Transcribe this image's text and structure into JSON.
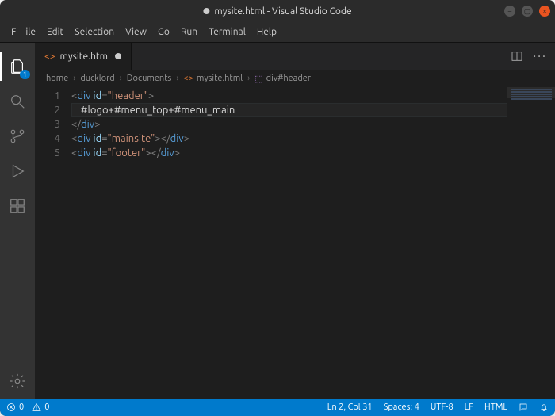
{
  "window": {
    "title": "mysite.html - Visual Studio Code",
    "modified": true
  },
  "menubar": [
    "File",
    "Edit",
    "Selection",
    "View",
    "Go",
    "Run",
    "Terminal",
    "Help"
  ],
  "activitybar": {
    "explorer_badge": "1"
  },
  "tab": {
    "filename": "mysite.html",
    "dirty": true
  },
  "breadcrumbs": {
    "parts": [
      "home",
      "ducklord",
      "Documents"
    ],
    "file": "mysite.html",
    "symbol": "div#header"
  },
  "editor": {
    "lines": [
      {
        "num": 1,
        "tokens": [
          {
            "cls": "t-punc",
            "txt": "<"
          },
          {
            "cls": "t-tag",
            "txt": "div"
          },
          {
            "cls": "t-plain",
            "txt": " "
          },
          {
            "cls": "t-attr",
            "txt": "id"
          },
          {
            "cls": "t-punc",
            "txt": "="
          },
          {
            "cls": "t-str",
            "txt": "\"header\""
          },
          {
            "cls": "t-punc",
            "txt": ">"
          }
        ]
      },
      {
        "num": 2,
        "current": true,
        "tokens": [
          {
            "cls": "t-plain",
            "txt": "    #logo+#menu_top+#menu_main"
          }
        ],
        "cursorAfter": true
      },
      {
        "num": 3,
        "tokens": [
          {
            "cls": "t-punc",
            "txt": "</"
          },
          {
            "cls": "t-tag",
            "txt": "div"
          },
          {
            "cls": "t-punc",
            "txt": ">"
          }
        ]
      },
      {
        "num": 4,
        "tokens": [
          {
            "cls": "t-punc",
            "txt": "<"
          },
          {
            "cls": "t-tag",
            "txt": "div"
          },
          {
            "cls": "t-plain",
            "txt": " "
          },
          {
            "cls": "t-attr",
            "txt": "id"
          },
          {
            "cls": "t-punc",
            "txt": "="
          },
          {
            "cls": "t-str",
            "txt": "\"mainsite\""
          },
          {
            "cls": "t-punc",
            "txt": "></"
          },
          {
            "cls": "t-tag",
            "txt": "div"
          },
          {
            "cls": "t-punc",
            "txt": ">"
          }
        ]
      },
      {
        "num": 5,
        "tokens": [
          {
            "cls": "t-punc",
            "txt": "<"
          },
          {
            "cls": "t-tag",
            "txt": "div"
          },
          {
            "cls": "t-plain",
            "txt": " "
          },
          {
            "cls": "t-attr",
            "txt": "id"
          },
          {
            "cls": "t-punc",
            "txt": "="
          },
          {
            "cls": "t-str",
            "txt": "\"footer\""
          },
          {
            "cls": "t-punc",
            "txt": "></"
          },
          {
            "cls": "t-tag",
            "txt": "div"
          },
          {
            "cls": "t-punc",
            "txt": ">"
          }
        ]
      }
    ]
  },
  "statusbar": {
    "errors": "0",
    "warnings": "0",
    "line_col": "Ln 2, Col 31",
    "spaces": "Spaces: 4",
    "encoding": "UTF-8",
    "eol": "LF",
    "language": "HTML"
  }
}
